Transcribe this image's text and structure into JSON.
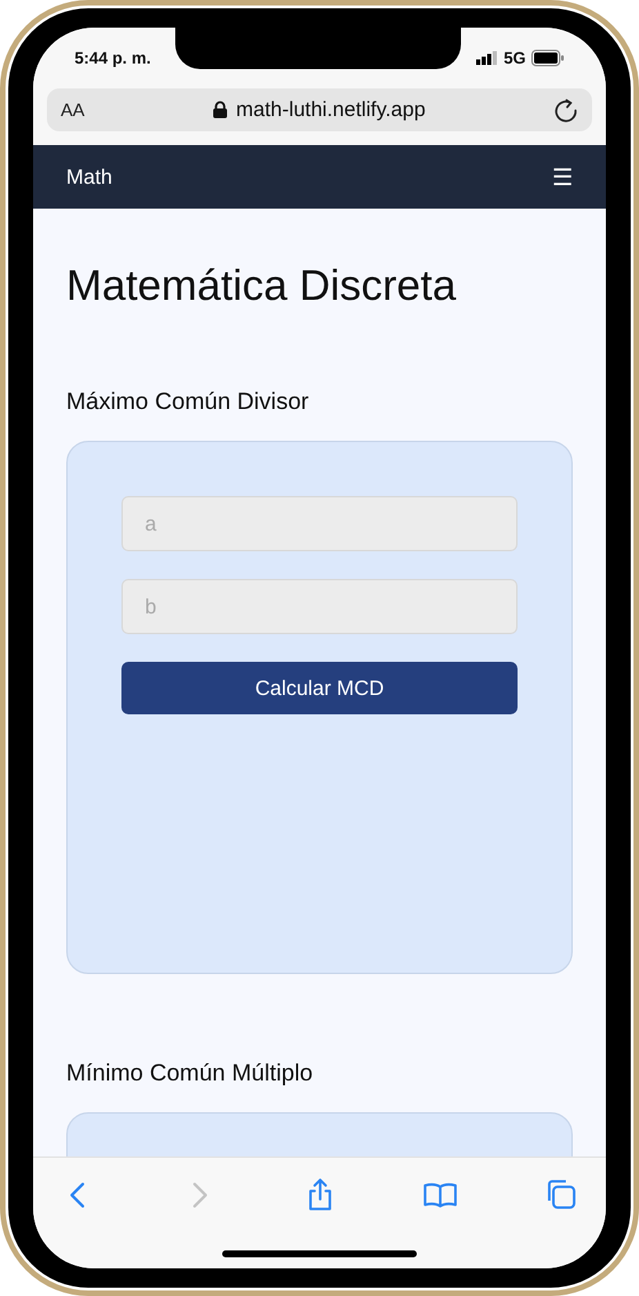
{
  "status_bar": {
    "time": "5:44 p. m.",
    "network": "5G"
  },
  "browser": {
    "text_size": "AA",
    "url": "math-luthi.netlify.app"
  },
  "navbar": {
    "brand": "Math",
    "menu": "☰"
  },
  "page": {
    "title": "Matemática Discreta",
    "sections": [
      {
        "heading": "Máximo Común Divisor",
        "fields": [
          {
            "placeholder": "a"
          },
          {
            "placeholder": "b"
          }
        ],
        "button": "Calcular MCD"
      },
      {
        "heading": "Mínimo Común Múltiplo"
      }
    ]
  },
  "toolbar": [
    {
      "kind": "back",
      "disabled": false
    },
    {
      "kind": "forward",
      "disabled": true
    },
    {
      "kind": "share",
      "disabled": false
    },
    {
      "kind": "bookmarks",
      "disabled": false
    },
    {
      "kind": "tabs",
      "disabled": false
    }
  ]
}
